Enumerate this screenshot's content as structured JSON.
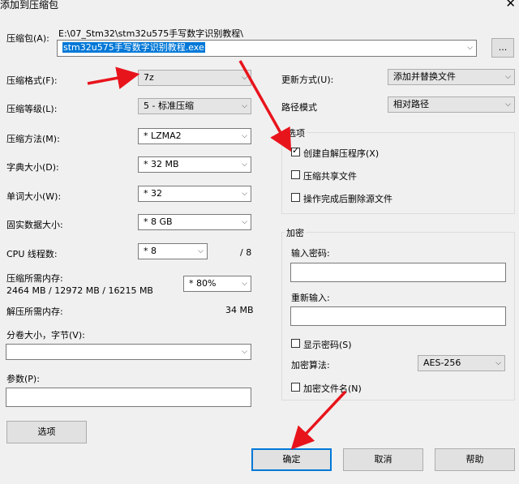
{
  "window": {
    "title": "添加到压缩包",
    "close_glyph": "✕"
  },
  "archive": {
    "label": "压缩包(A):",
    "path": "E:\\07_Stm32\\stm32u575手写数字识别教程\\",
    "filename": "stm32u575手写数字识别教程.exe",
    "browse_label": "..."
  },
  "left": {
    "format": {
      "label": "压缩格式(F):",
      "value": "7z"
    },
    "level": {
      "label": "压缩等级(L):",
      "value": "5 - 标准压缩"
    },
    "method": {
      "label": "压缩方法(M):",
      "value": "*  LZMA2"
    },
    "dict": {
      "label": "字典大小(D):",
      "value": "*  32 MB"
    },
    "word": {
      "label": "单词大小(W):",
      "value": "*  32"
    },
    "solid": {
      "label": "固实数据大小:",
      "value": "*  8 GB"
    },
    "cpu": {
      "label": "CPU 线程数:",
      "value": "*  8",
      "max": "/ 8"
    },
    "mem_compress": {
      "label": "压缩所需内存:",
      "detail": "2464 MB / 12972 MB / 16215 MB",
      "value": "*  80%"
    },
    "mem_decompress": {
      "label": "解压所需内存:",
      "value": "34 MB"
    },
    "split": {
      "label": "分卷大小，字节(V):",
      "value": ""
    },
    "params": {
      "label": "参数(P):",
      "value": ""
    },
    "options_button": "选项"
  },
  "right": {
    "update": {
      "label": "更新方式(U):",
      "value": "添加并替换文件"
    },
    "pathmode": {
      "label": "路径模式",
      "value": "相对路径"
    },
    "options_group": {
      "title": "选项",
      "sfx": {
        "label": "创建自解压程序(X)",
        "checked": true
      },
      "shared": {
        "label": "压缩共享文件",
        "checked": false
      },
      "delete": {
        "label": "操作完成后删除源文件",
        "checked": false
      }
    },
    "encrypt_group": {
      "title": "加密",
      "password_label": "输入密码:",
      "reenter_label": "重新输入:",
      "show_password": "显示密码(S)",
      "method_label": "加密算法:",
      "method_value": "AES-256",
      "encrypt_names": "加密文件名(N)"
    }
  },
  "buttons": {
    "ok": "确定",
    "cancel": "取消",
    "help": "帮助"
  },
  "annotation_color": "#e8141c"
}
